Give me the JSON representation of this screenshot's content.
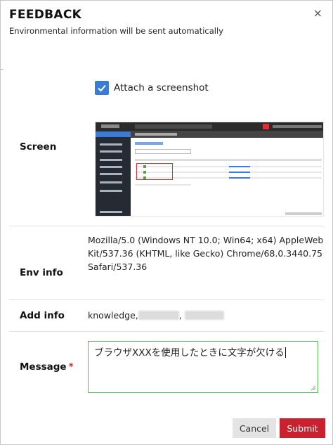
{
  "dialog": {
    "title": "FEEDBACK",
    "subtitle": "Environmental information will be sent automatically",
    "close_symbol": "×"
  },
  "attach": {
    "checked": true,
    "label": "Attach a screenshot"
  },
  "rows": {
    "screen_label": "Screen",
    "env_label": "Env info",
    "env_value": "Mozilla/5.0 (Windows NT 10.0; Win64; x64) AppleWebKit/537.36 (KHTML, like Gecko) Chrome/68.0.3440.75 Safari/537.36",
    "add_label": "Add info",
    "add_value_prefix": "knowledge,",
    "add_value_sep": ",",
    "message_label": "Message",
    "required_mark": "*",
    "message_value": "ブラウザXXXを使用したときに文字が欠ける"
  },
  "buttons": {
    "cancel": "Cancel",
    "submit": "Submit"
  },
  "colors": {
    "accent": "#3a7bd5",
    "submit": "#c9222e",
    "message_border": "#5cb85c",
    "required": "#d9303a"
  }
}
